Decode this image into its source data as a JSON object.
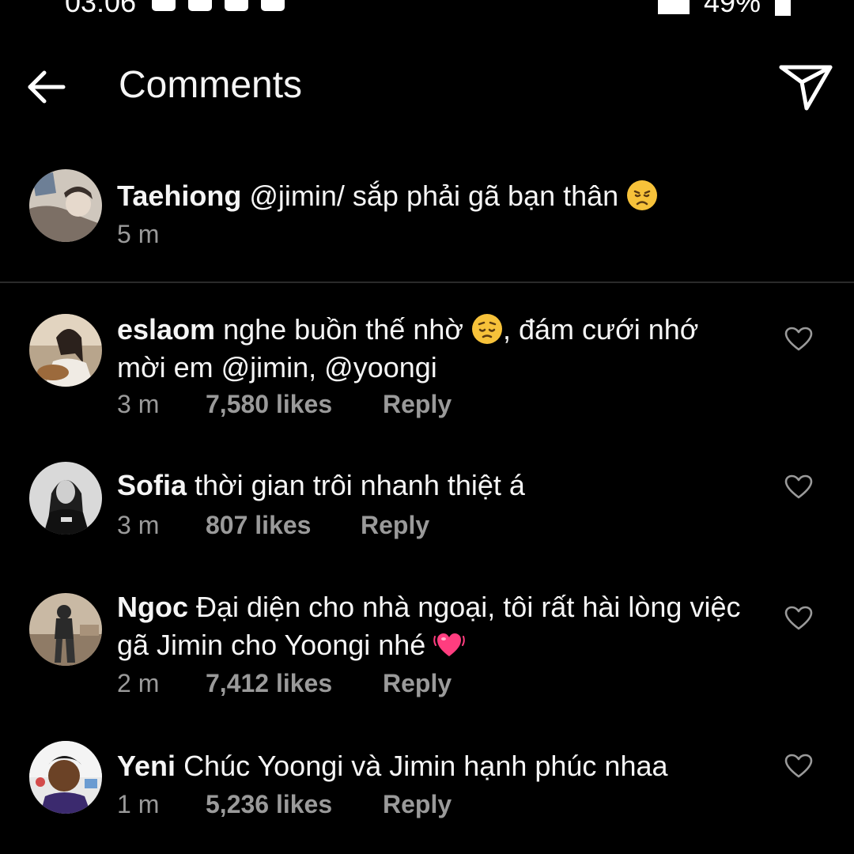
{
  "status_bar": {
    "time": "03:06",
    "battery": "49%"
  },
  "header": {
    "title": "Comments",
    "back_icon": "arrow-left-icon",
    "send_icon": "paper-plane-icon"
  },
  "caption": {
    "username": "Taehiong",
    "text": "@jimin/ sắp phải gã bạn thân",
    "emoji": "disappointed-face-emoji",
    "time": "5 m"
  },
  "comments": [
    {
      "username": "eslaom",
      "text_before": "nghe buồn thế nhờ",
      "emoji": "pensive-face-emoji",
      "text_after": ", đám cưới nhớ mời em @jimin, @yoongi",
      "time": "3 m",
      "likes": "7,580 likes",
      "reply": "Reply"
    },
    {
      "username": "Sofia",
      "text_before": "thời gian trôi nhanh thiệt á",
      "emoji": "",
      "text_after": "",
      "time": "3 m",
      "likes": "807 likes",
      "reply": "Reply"
    },
    {
      "username": "Ngoc",
      "text_before": "Đại diện cho nhà ngoại, tôi rất hài lòng việc gã Jimin cho Yoongi nhé",
      "emoji": "beating-heart-emoji",
      "text_after": "",
      "time": "2 m",
      "likes": "7,412 likes",
      "reply": "Reply"
    },
    {
      "username": "Yeni",
      "text_before": "Chúc Yoongi và Jimin hạnh phúc nhaa",
      "emoji": "",
      "text_after": "",
      "time": "1 m",
      "likes": "5,236 likes",
      "reply": "Reply"
    }
  ],
  "colors": {
    "background": "#000000",
    "text": "#f5f5f5",
    "secondary_text": "#9a9a9a",
    "divider": "#2a2a2a"
  }
}
